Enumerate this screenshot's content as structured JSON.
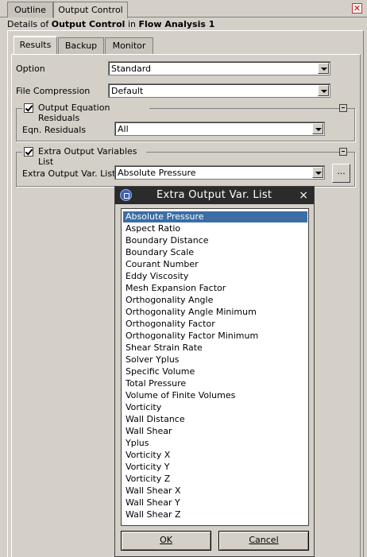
{
  "top_tabs": [
    {
      "label": "Outline",
      "active": false
    },
    {
      "label": "Output Control",
      "active": true
    }
  ],
  "details": {
    "prefix": "Details of",
    "object": "Output Control",
    "mid": "in",
    "parent": "Flow Analysis 1"
  },
  "inner_tabs": [
    {
      "label": "Results",
      "active": true
    },
    {
      "label": "Backup",
      "active": false
    },
    {
      "label": "Monitor",
      "active": false
    }
  ],
  "option": {
    "label": "Option",
    "value": "Standard"
  },
  "file_compression": {
    "label": "File Compression",
    "value": "Default"
  },
  "residuals_group": {
    "title": "Output Equation Residuals",
    "checked": true,
    "field_label": "Eqn. Residuals",
    "value": "All"
  },
  "extra_group": {
    "title": "Extra Output Variables List",
    "checked": true,
    "field_label": "Extra Output Var. List",
    "value": "Absolute Pressure",
    "browse_label": "..."
  },
  "popup": {
    "title": "Extra Output Var. List",
    "close": "×",
    "selected_index": 0,
    "items": [
      "Absolute Pressure",
      "Aspect Ratio",
      "Boundary Distance",
      "Boundary Scale",
      "Courant Number",
      "Eddy Viscosity",
      "Mesh Expansion Factor",
      "Orthogonality Angle",
      "Orthogonality Angle Minimum",
      "Orthogonality Factor",
      "Orthogonality Factor Minimum",
      "Shear Strain Rate",
      "Solver Yplus",
      "Specific Volume",
      "Total Pressure",
      "Volume of Finite Volumes",
      "Vorticity",
      "Wall Distance",
      "Wall Shear",
      "Yplus",
      "Vorticity X",
      "Vorticity Y",
      "Vorticity Z",
      "Wall Shear X",
      "Wall Shear Y",
      "Wall Shear Z"
    ],
    "ok_label": "OK",
    "cancel_label": "Cancel"
  },
  "colors": {
    "selection": "#3a6ea5",
    "title_bar": "#2b2b2b",
    "close_red": "#cc0000"
  }
}
